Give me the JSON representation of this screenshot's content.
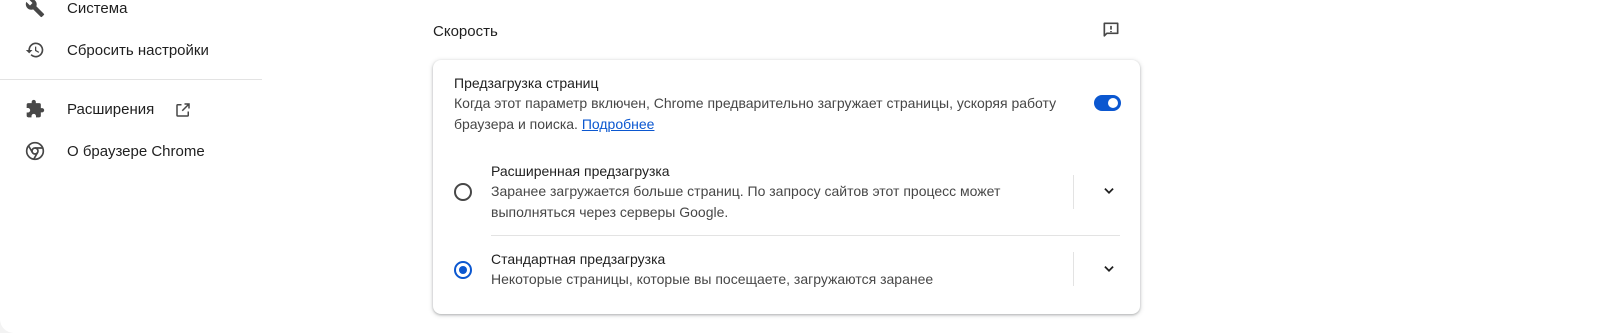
{
  "sidebar": {
    "items": [
      {
        "label": "Система",
        "icon": "wrench-icon"
      },
      {
        "label": "Сбросить настройки",
        "icon": "reset-history-icon"
      },
      {
        "label": "Расширения",
        "icon": "puzzle-icon"
      },
      {
        "label": "О браузере Chrome",
        "icon": "chrome-icon"
      }
    ]
  },
  "section": {
    "title": "Скорость"
  },
  "preload": {
    "title": "Предзагрузка страниц",
    "desc": "Когда этот параметр включен, Chrome предварительно загружает страницы, ускоряя работу браузера и поиска.",
    "link": "Подробнее",
    "enabled": true
  },
  "options": [
    {
      "title": "Расширенная предзагрузка",
      "desc": "Заранее загружается больше страниц. По запросу сайтов этот процесс может выполняться через серверы Google.",
      "selected": false
    },
    {
      "title": "Стандартная предзагрузка",
      "desc": "Некоторые страницы, которые вы посещаете, загружаются заранее",
      "selected": true
    }
  ],
  "colors": {
    "accent": "#0b57d0",
    "text": "#1f1f1f",
    "secondary": "#474747"
  }
}
